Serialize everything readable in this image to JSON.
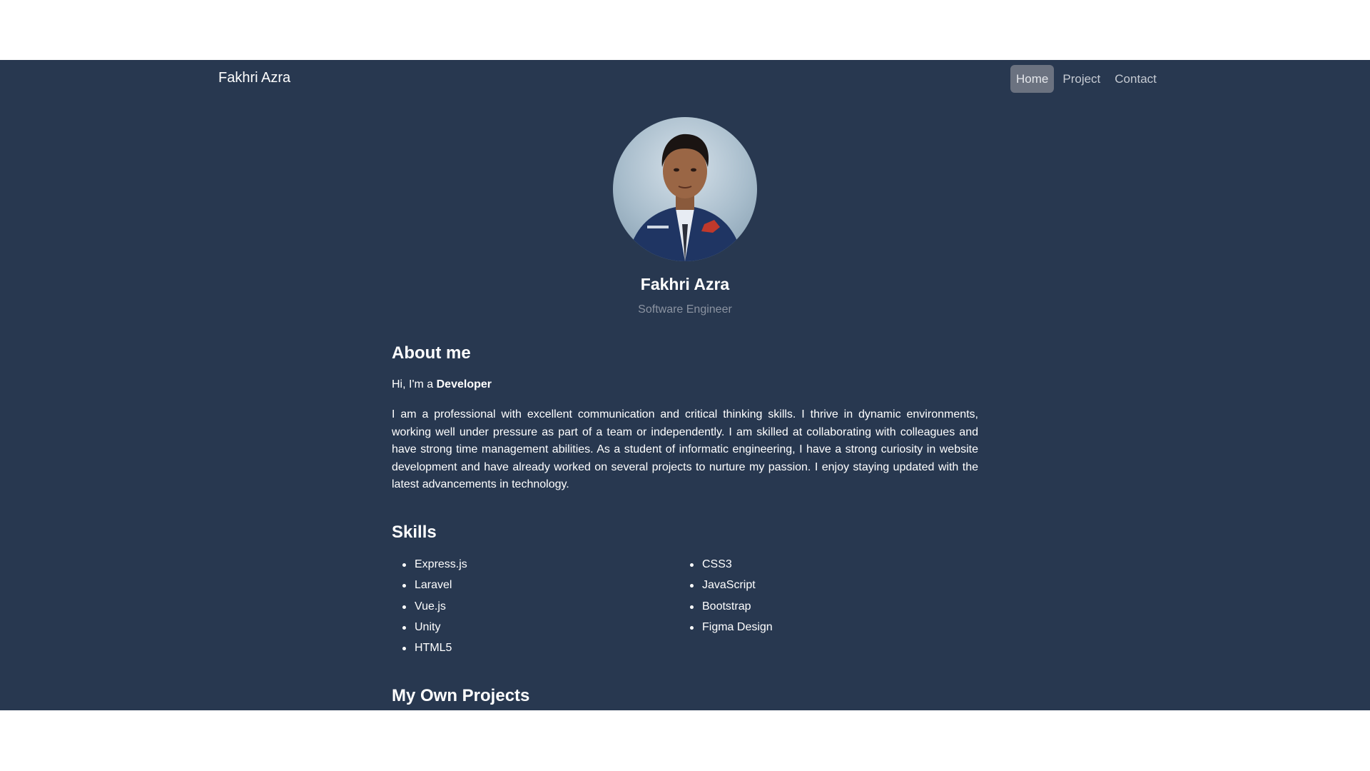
{
  "navbar": {
    "brand": "Fakhri Azra",
    "links": [
      {
        "label": "Home",
        "active": true
      },
      {
        "label": "Project",
        "active": false
      },
      {
        "label": "Contact",
        "active": false
      }
    ]
  },
  "profile": {
    "name": "Fakhri Azra",
    "role": "Software Engineer"
  },
  "about": {
    "title": "About me",
    "intro_prefix": "Hi, I'm a",
    "intro_bold": "Developer",
    "bio": "I am a professional with excellent communication and critical thinking skills. I thrive in dynamic environments, working well under pressure as part of a team or independently. I am skilled at collaborating with colleagues and have strong time management abilities. As a student of informatic engineering, I have a strong curiosity in website development and have already worked on several projects to nurture my passion. I enjoy staying updated with the latest advancements in technology."
  },
  "skills": {
    "title": "Skills",
    "column_left": [
      "Express.js",
      "Laravel",
      "Vue.js",
      "Unity",
      "HTML5"
    ],
    "column_right": [
      "CSS3",
      "JavaScript",
      "Bootstrap",
      "Figma Design"
    ]
  },
  "projects": {
    "title": "My Own Projects"
  },
  "colors": {
    "page_bg": "#283850",
    "outer_bg": "#ffffff",
    "nav_active_bg": "#6b7280",
    "muted_text": "#8b93a1"
  }
}
